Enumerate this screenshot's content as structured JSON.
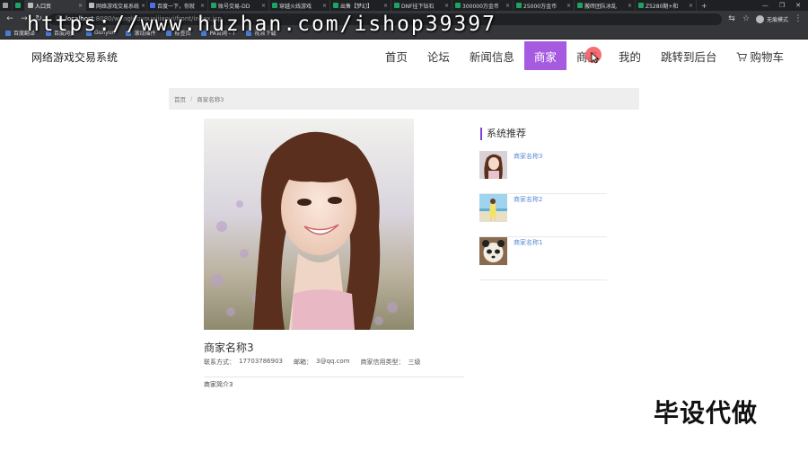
{
  "browser": {
    "tabs": [
      {
        "label": "",
        "color": "#9aa0a6"
      },
      {
        "label": "",
        "color": "#1ea362"
      },
      {
        "label": "入口页",
        "color": "#bbbbbb"
      },
      {
        "label": "网络游戏交易系统",
        "color": "#bbbbbb"
      },
      {
        "label": "百度一下，你就",
        "color": "#4e6ef2"
      },
      {
        "label": "账号交易-DD",
        "color": "#1ea362"
      },
      {
        "label": "穿越火线游戏",
        "color": "#1ea362"
      },
      {
        "label": "出售【梦幻】",
        "color": "#1ea362"
      },
      {
        "label": "DNF挂下钻石",
        "color": "#1ea362"
      },
      {
        "label": "300000万金币",
        "color": "#1ea362"
      },
      {
        "label": "25000万金币",
        "color": "#1ea362"
      },
      {
        "label": "搬砖团队冰乱",
        "color": "#1ea362"
      },
      {
        "label": "Z5280期+和",
        "color": "#1ea362"
      }
    ],
    "new_tab": "+",
    "url_host": "localhost",
    "url_path": ":8080/wangluoyouxijiaoyi/front/index.jsp",
    "profile_label": "无痕模式",
    "bookmarks": [
      "百度翻译",
      "百度网盘",
      "Gunyun",
      "滚动插件",
      "标签页",
      "PA官网 - T",
      "视频下载"
    ]
  },
  "watermark": "https://www.huzhan.com/ishop39397",
  "header": {
    "site_title": "网络游戏交易系统",
    "nav": [
      {
        "label": "首页",
        "active": false
      },
      {
        "label": "论坛",
        "active": false
      },
      {
        "label": "新闻信息",
        "active": false
      },
      {
        "label": "商家",
        "active": true
      },
      {
        "label": "商品",
        "active": false
      },
      {
        "label": "我的",
        "active": false
      },
      {
        "label": "跳转到后台",
        "active": false
      }
    ],
    "cart_label": "购物车",
    "accent": "#a55ae0"
  },
  "breadcrumb": {
    "home": "首页",
    "sep": "/",
    "current": "商家名称3"
  },
  "merchant": {
    "name": "商家名称3",
    "contact_label": "联系方式：",
    "contact": "17703786903",
    "email_label": "邮箱：",
    "email": "3@qq.com",
    "credit_label": "商家信用类型：",
    "credit": "三级",
    "intro": "商家简介3"
  },
  "recommend": {
    "title": "系统推荐",
    "items": [
      {
        "name": "商家名称3",
        "thumb": "girl"
      },
      {
        "name": "商家名称2",
        "thumb": "beach"
      },
      {
        "name": "商家名称1",
        "thumb": "panda"
      }
    ]
  },
  "corner_text": "毕设代做"
}
